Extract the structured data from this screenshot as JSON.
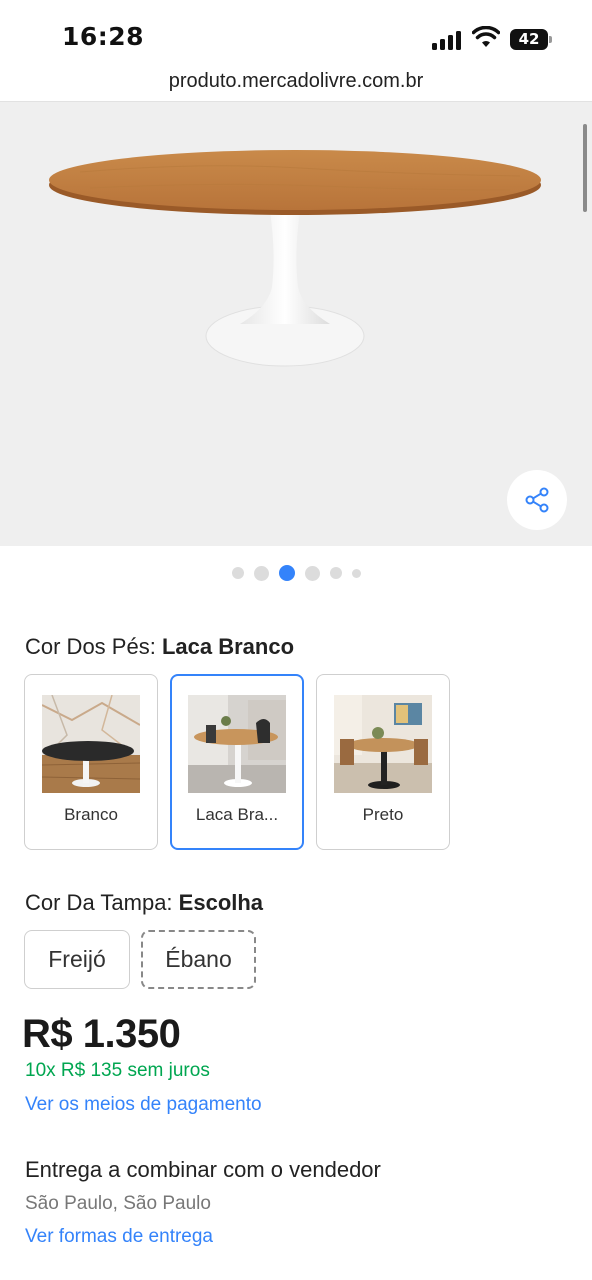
{
  "status_bar": {
    "time": "16:28",
    "battery_level": "42"
  },
  "browser": {
    "url": "produto.mercadolivre.com.br"
  },
  "gallery": {
    "image_count": 6,
    "active_index": 2
  },
  "leg_color": {
    "label": "Cor Dos Pés:",
    "selected_value": "Laca Branco",
    "options": [
      {
        "label": "Branco"
      },
      {
        "label": "Laca Bra..."
      },
      {
        "label": "Preto"
      }
    ]
  },
  "top_color": {
    "label": "Cor Da Tampa:",
    "selected_value": "Escolha",
    "options": [
      {
        "label": "Freijó"
      },
      {
        "label": "Ébano"
      }
    ]
  },
  "price": {
    "currency": "R$",
    "amount": "1.350",
    "installments": "10x R$ 135 sem juros",
    "payment_link": "Ver os meios de pagamento"
  },
  "shipping": {
    "title": "Entrega a combinar com o vendedor",
    "location": "São Paulo, São Paulo",
    "link": "Ver formas de entrega"
  },
  "colors": {
    "accent": "#3483fa",
    "green": "#00a650"
  },
  "icons": {
    "share": "share-icon"
  }
}
